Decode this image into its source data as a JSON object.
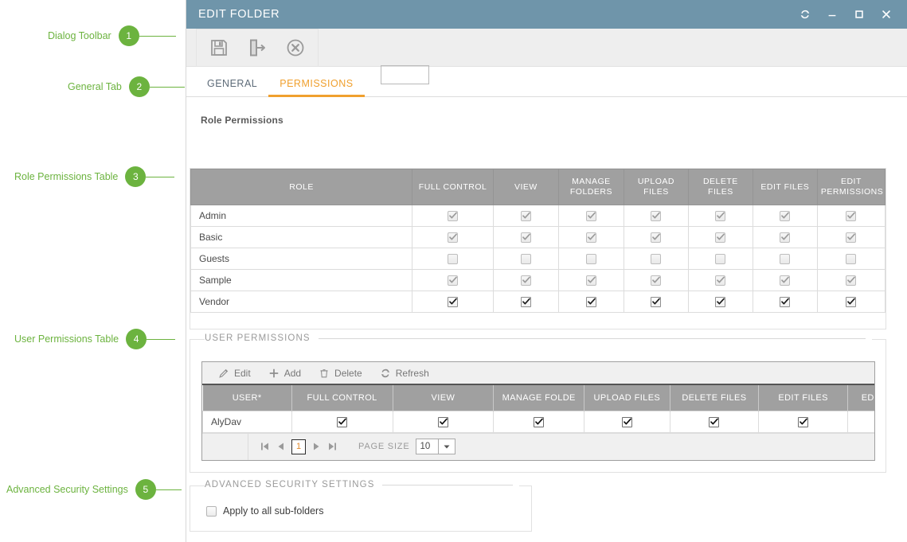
{
  "callouts": [
    {
      "num": "1",
      "label": "Dialog Toolbar"
    },
    {
      "num": "2",
      "label": "General Tab"
    },
    {
      "num": "3",
      "label": "Role Permissions Table"
    },
    {
      "num": "4",
      "label": "User Permissions Table"
    },
    {
      "num": "5",
      "label": "Advanced Security Settings"
    }
  ],
  "dialog": {
    "title": "EDIT FOLDER",
    "window_buttons": [
      {
        "name": "refresh-icon",
        "tooltip": "Refresh"
      },
      {
        "name": "minimize-icon",
        "tooltip": "Minimize"
      },
      {
        "name": "maximize-icon",
        "tooltip": "Maximize"
      },
      {
        "name": "close-icon",
        "tooltip": "Close"
      }
    ],
    "toolbar": [
      {
        "name": "save-icon",
        "tooltip": "Save"
      },
      {
        "name": "save-and-close-icon",
        "tooltip": "Save and Close"
      },
      {
        "name": "cancel-icon",
        "tooltip": "Cancel"
      }
    ],
    "tabs": [
      {
        "label": "GENERAL",
        "active": false
      },
      {
        "label": "PERMISSIONS",
        "active": true
      }
    ]
  },
  "role_section": {
    "heading": "Role Permissions",
    "columns": [
      "ROLE",
      "FULL CONTROL",
      "VIEW",
      "MANAGE FOLDERS",
      "UPLOAD FILES",
      "DELETE FILES",
      "EDIT FILES",
      "EDIT PERMISSIONS"
    ],
    "rows": [
      {
        "role": "Admin",
        "state": "checked-disabled",
        "values": [
          true,
          true,
          true,
          true,
          true,
          true,
          true
        ]
      },
      {
        "role": "Basic",
        "state": "checked-disabled",
        "values": [
          true,
          true,
          true,
          true,
          true,
          true,
          true
        ]
      },
      {
        "role": "Guests",
        "state": "unchecked-disabled",
        "values": [
          false,
          false,
          false,
          false,
          false,
          false,
          false
        ]
      },
      {
        "role": "Sample",
        "state": "checked-disabled",
        "values": [
          true,
          true,
          true,
          true,
          true,
          true,
          true
        ]
      },
      {
        "role": "Vendor",
        "state": "checked-enabled",
        "values": [
          true,
          true,
          true,
          true,
          true,
          true,
          true
        ]
      }
    ]
  },
  "user_section": {
    "legend": "USER PERMISSIONS",
    "toolbar": [
      {
        "label": "Edit",
        "icon": "pencil-icon"
      },
      {
        "label": "Add",
        "icon": "plus-icon"
      },
      {
        "label": "Delete",
        "icon": "trash-icon"
      },
      {
        "label": "Refresh",
        "icon": "refresh-icon"
      }
    ],
    "columns": [
      "USER*",
      "FULL CONTROL",
      "VIEW",
      "MANAGE FOLDE",
      "UPLOAD FILES",
      "DELETE FILES",
      "EDIT FILES",
      "EDIT PERMISSIO"
    ],
    "rows": [
      {
        "user": "AlyDav",
        "values": [
          true,
          true,
          true,
          true,
          true,
          true,
          true
        ]
      }
    ],
    "pager": {
      "first_icon": "first-page-icon",
      "prev_icon": "prev-page-icon",
      "page": "1",
      "next_icon": "next-page-icon",
      "last_icon": "last-page-icon",
      "page_size_label": "PAGE SIZE",
      "page_size_value": "10"
    }
  },
  "advanced_section": {
    "legend": "ADVANCED SECURITY SETTINGS",
    "checkbox_label": "Apply to all sub-folders",
    "checked": false
  },
  "colors": {
    "titlebar": "#6f95aa",
    "accent_orange": "#f0a02e",
    "callout_green": "#6cb33f",
    "header_gray": "#a0a0a0"
  }
}
